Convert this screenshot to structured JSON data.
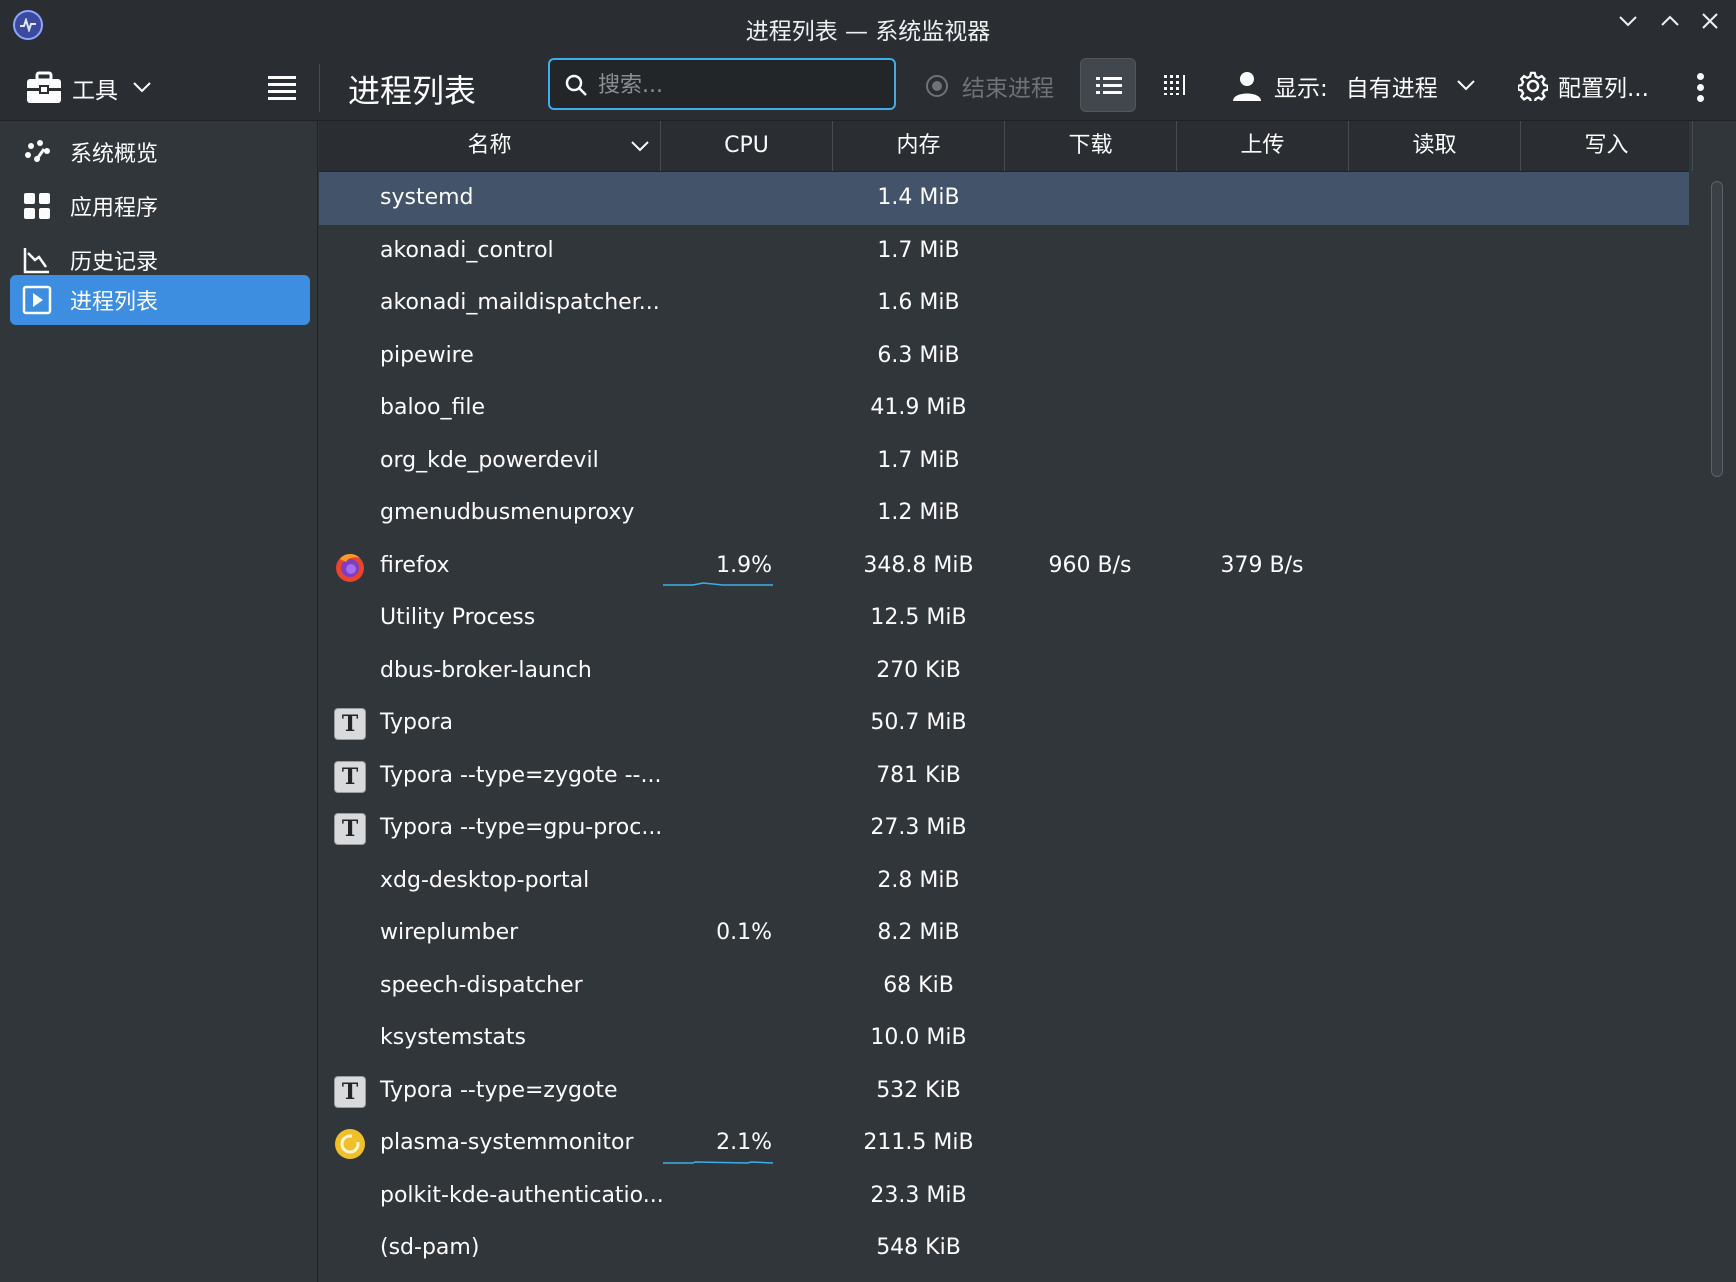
{
  "window": {
    "title": "进程列表 — 系统监视器"
  },
  "toolbar": {
    "tools_label": "工具",
    "page_title": "进程列表",
    "search_placeholder": "搜索...",
    "end_process_label": "结束进程",
    "show_label": "显示:",
    "show_value": "自有进程",
    "config_label": "配置列..."
  },
  "sidebar": {
    "items": [
      {
        "label": "系统概览",
        "icon": "overview-icon"
      },
      {
        "label": "应用程序",
        "icon": "applications-icon"
      },
      {
        "label": "历史记录",
        "icon": "history-icon"
      },
      {
        "label": "进程列表",
        "icon": "process-list-icon",
        "active": true
      }
    ]
  },
  "table": {
    "columns": [
      "名称",
      "CPU",
      "内存",
      "下载",
      "上传",
      "读取",
      "写入"
    ],
    "rows": [
      {
        "name": "systemd",
        "cpu": "",
        "memory": "1.4 MiB",
        "download": "",
        "upload": "",
        "icon": "",
        "selected": true
      },
      {
        "name": "akonadi_control",
        "cpu": "",
        "memory": "1.7 MiB",
        "download": "",
        "upload": "",
        "icon": ""
      },
      {
        "name": "akonadi_maildispatcher...",
        "cpu": "",
        "memory": "1.6 MiB",
        "download": "",
        "upload": "",
        "icon": ""
      },
      {
        "name": "pipewire",
        "cpu": "",
        "memory": "6.3 MiB",
        "download": "",
        "upload": "",
        "icon": ""
      },
      {
        "name": "baloo_file",
        "cpu": "",
        "memory": "41.9 MiB",
        "download": "",
        "upload": "",
        "icon": ""
      },
      {
        "name": "org_kde_powerdevil",
        "cpu": "",
        "memory": "1.7 MiB",
        "download": "",
        "upload": "",
        "icon": ""
      },
      {
        "name": "gmenudbusmenuproxy",
        "cpu": "",
        "memory": "1.2 MiB",
        "download": "",
        "upload": "",
        "icon": ""
      },
      {
        "name": "firefox",
        "cpu": "1.9%",
        "memory": "348.8 MiB",
        "download": "960 B/s",
        "upload": "379 B/s",
        "icon": "firefox-icon"
      },
      {
        "name": "Utility Process",
        "cpu": "",
        "memory": "12.5 MiB",
        "download": "",
        "upload": "",
        "icon": ""
      },
      {
        "name": "dbus-broker-launch",
        "cpu": "",
        "memory": "270 KiB",
        "download": "",
        "upload": "",
        "icon": ""
      },
      {
        "name": "Typora",
        "cpu": "",
        "memory": "50.7 MiB",
        "download": "",
        "upload": "",
        "icon": "typora-icon"
      },
      {
        "name": "Typora --type=zygote --...",
        "cpu": "",
        "memory": "781 KiB",
        "download": "",
        "upload": "",
        "icon": "typora-icon"
      },
      {
        "name": "Typora --type=gpu-proc...",
        "cpu": "",
        "memory": "27.3 MiB",
        "download": "",
        "upload": "",
        "icon": "typora-icon"
      },
      {
        "name": "xdg-desktop-portal",
        "cpu": "",
        "memory": "2.8 MiB",
        "download": "",
        "upload": "",
        "icon": ""
      },
      {
        "name": "wireplumber",
        "cpu": "0.1%",
        "memory": "8.2 MiB",
        "download": "",
        "upload": "",
        "icon": ""
      },
      {
        "name": "speech-dispatcher",
        "cpu": "",
        "memory": "68 KiB",
        "download": "",
        "upload": "",
        "icon": ""
      },
      {
        "name": "ksystemstats",
        "cpu": "",
        "memory": "10.0 MiB",
        "download": "",
        "upload": "",
        "icon": ""
      },
      {
        "name": "Typora --type=zygote",
        "cpu": "",
        "memory": "532 KiB",
        "download": "",
        "upload": "",
        "icon": "typora-icon"
      },
      {
        "name": "plasma-systemmonitor",
        "cpu": "2.1%",
        "memory": "211.5 MiB",
        "download": "",
        "upload": "",
        "icon": "system-monitor-icon"
      },
      {
        "name": "polkit-kde-authenticatio...",
        "cpu": "",
        "memory": "23.3 MiB",
        "download": "",
        "upload": "",
        "icon": ""
      },
      {
        "name": "(sd-pam)",
        "cpu": "",
        "memory": "548 KiB",
        "download": "",
        "upload": "",
        "icon": ""
      }
    ]
  },
  "colors": {
    "window_bg": "#31363b",
    "toolbar_bg": "#2a2e32",
    "accent": "#3daee9",
    "sidebar_active": "#3d8ee0",
    "row_selected": "#43536a",
    "text": "#fcfcfc"
  }
}
